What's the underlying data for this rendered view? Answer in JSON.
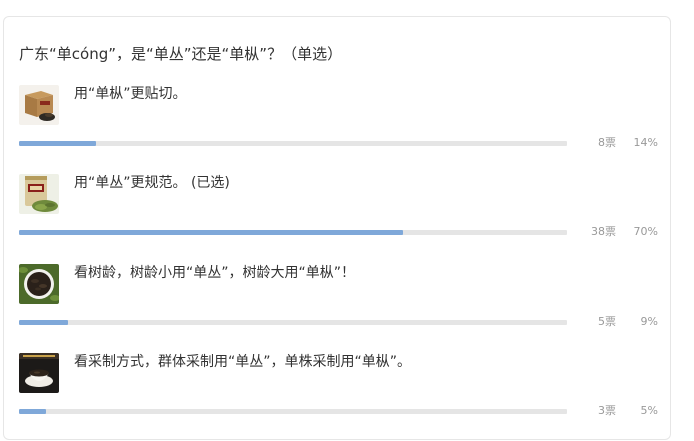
{
  "poll": {
    "question": "广东“单cóng”，是“单丛”还是“单枞”？（单选）",
    "options": [
      {
        "label": "用“单枞”更贴切。",
        "votes": "8票",
        "percent": "14%",
        "fraction": 0.14,
        "thumb_icon": "tea-box-thumbnail"
      },
      {
        "label": "用“单丛”更规范。 (已选)",
        "votes": "38票",
        "percent": "70%",
        "fraction": 0.7,
        "thumb_icon": "tea-can-thumbnail"
      },
      {
        "label": "看树龄，树龄小用“单丛”，树龄大用“单枞”！",
        "votes": "5票",
        "percent": "9%",
        "fraction": 0.09,
        "thumb_icon": "tea-leaves-thumbnail"
      },
      {
        "label": "看采制方式，群体采制用“单丛”，单株采制用“单枞”。",
        "votes": "3票",
        "percent": "5%",
        "fraction": 0.05,
        "thumb_icon": "tea-cup-thumbnail"
      }
    ]
  },
  "colors": {
    "bar_fill": "#7fa8d9",
    "bar_track": "#e5e5e5",
    "muted_text": "#999999"
  }
}
